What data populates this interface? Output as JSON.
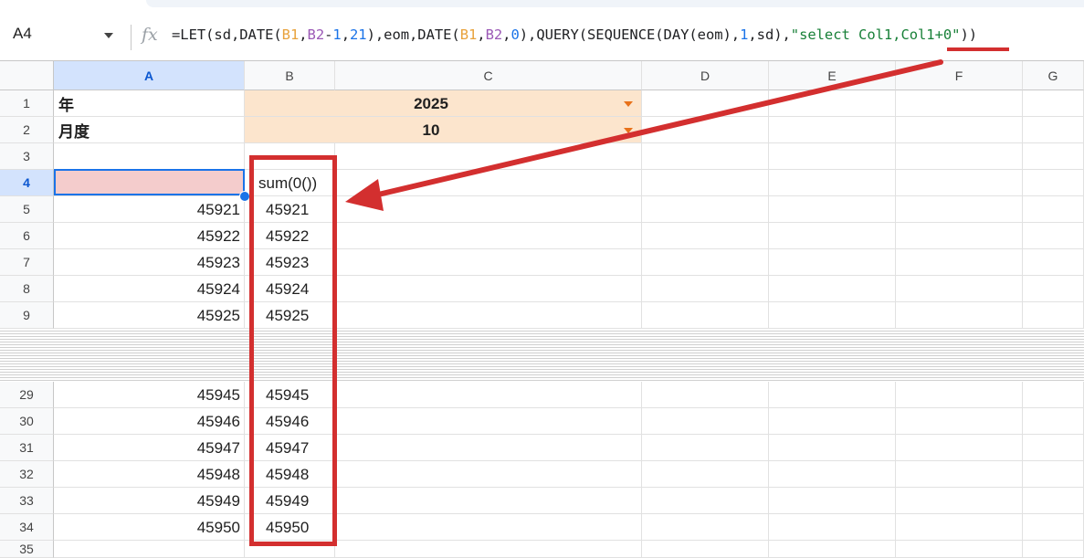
{
  "name_box": "A4",
  "fx_icon": "fx-icon",
  "formula": {
    "parts": [
      {
        "t": "=LET(sd,DATE(",
        "c": ""
      },
      {
        "t": "B1",
        "c": "c-ref1"
      },
      {
        "t": ",",
        "c": ""
      },
      {
        "t": "B2",
        "c": "c-ref2"
      },
      {
        "t": "-",
        "c": ""
      },
      {
        "t": "1",
        "c": "c-num"
      },
      {
        "t": ",",
        "c": ""
      },
      {
        "t": "21",
        "c": "c-num"
      },
      {
        "t": "),eom,DATE(",
        "c": ""
      },
      {
        "t": "B1",
        "c": "c-ref1"
      },
      {
        "t": ",",
        "c": ""
      },
      {
        "t": "B2",
        "c": "c-ref2"
      },
      {
        "t": ",",
        "c": ""
      },
      {
        "t": "0",
        "c": "c-num"
      },
      {
        "t": "),QUERY(SEQUENCE(DAY(eom),",
        "c": ""
      },
      {
        "t": "1",
        "c": "c-num"
      },
      {
        "t": ",sd),",
        "c": ""
      },
      {
        "t": "\"select Col1,Col1+0\"",
        "c": "c-str"
      },
      {
        "t": "))",
        "c": ""
      }
    ]
  },
  "columns": [
    "A",
    "B",
    "C",
    "D",
    "E",
    "F",
    "G"
  ],
  "rows": [
    "1",
    "2",
    "3",
    "4",
    "5",
    "6",
    "7",
    "8",
    "9",
    "29",
    "30",
    "31",
    "32",
    "33",
    "34",
    "35"
  ],
  "cells": {
    "r1_a": "年",
    "r2_a": "月度",
    "r1_bc": "2025",
    "r2_bc": "10",
    "r4_b": "sum(0())",
    "a_values": [
      "45921",
      "45922",
      "45923",
      "45924",
      "45925",
      "45945",
      "45946",
      "45947",
      "45948",
      "45949",
      "45950"
    ],
    "b_values": [
      "45921",
      "45922",
      "45923",
      "45924",
      "45925",
      "45945",
      "45946",
      "45947",
      "45948",
      "45949",
      "45950"
    ]
  },
  "colors": {
    "dropdown_fill": "#fce5cd",
    "selected_cell_fill": "#f4cccc",
    "annotation_red": "#d32f2f"
  }
}
